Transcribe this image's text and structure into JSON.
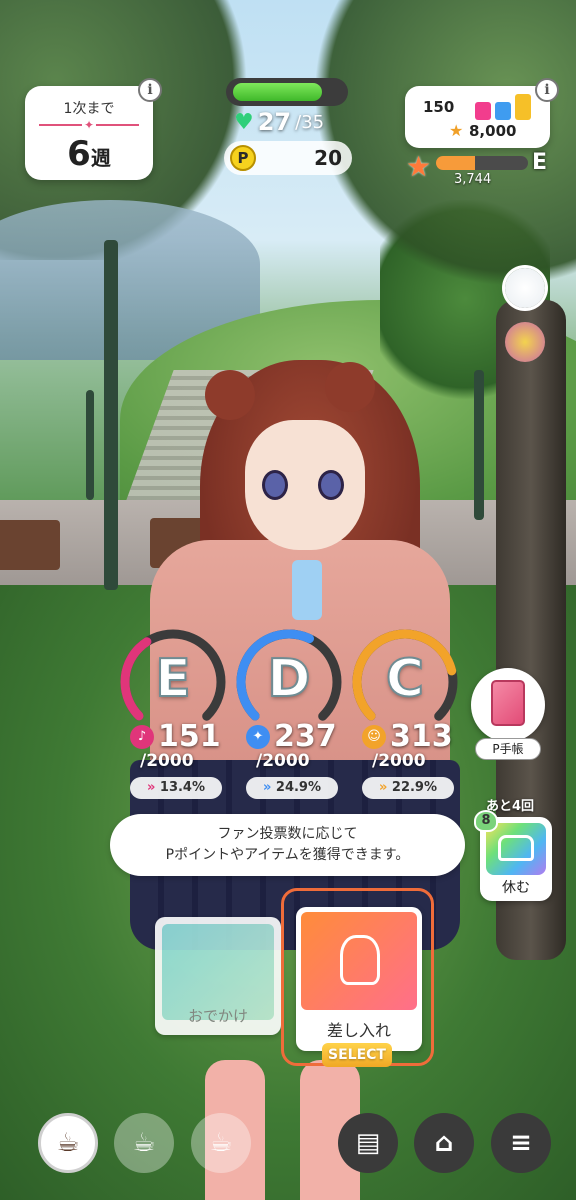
{
  "header": {
    "weeks_card": {
      "label": "1次まで",
      "divider_glyph": "✦",
      "value": "6",
      "unit": "週"
    },
    "stamina": {
      "current": "27",
      "max": "/35",
      "fill_fraction": 0.82
    },
    "p_points": {
      "icon": "P",
      "value": "20"
    },
    "items_card": {
      "count": "150",
      "score": "8,000"
    },
    "rank": {
      "letter": "E",
      "points": "3,744",
      "progress_fraction": 0.42
    },
    "info_glyph": "i"
  },
  "stats": [
    {
      "letter": "E",
      "value": "151",
      "max": "/2000",
      "growth": "13.4%",
      "color": "#e0357a",
      "icon": "mic-icon",
      "glyph": "♪"
    },
    {
      "letter": "D",
      "value": "237",
      "max": "/2000",
      "growth": "24.9%",
      "color": "#3f8ef2",
      "icon": "dance-icon",
      "glyph": "✦"
    },
    {
      "letter": "C",
      "value": "313",
      "max": "/2000",
      "growth": "22.9%",
      "color": "#f2a32a",
      "icon": "visual-icon",
      "glyph": "☺"
    }
  ],
  "growth_prefix": "»",
  "side": {
    "p_notebook_label": "P手帳",
    "rest_remaining": "あと4回",
    "rest_label": "休む",
    "rest_heart_value": "8"
  },
  "tooltip": {
    "line1": "ファン投票数に応じて",
    "line2": "Pポイントやアイテムを獲得できます。"
  },
  "actions": {
    "outing_label": "おでかけ",
    "gift_label": "差し入れ",
    "select_tag": "SELECT"
  },
  "bottom_bar": {
    "cup_glyph": "☕",
    "doc_glyph": "▤",
    "shop_glyph": "⌂",
    "menu_glyph": "≡"
  },
  "colors": {
    "accent": "#ef6c3a",
    "stamina_green": "#3fb82a",
    "rank_orange": "#f79b3a"
  }
}
